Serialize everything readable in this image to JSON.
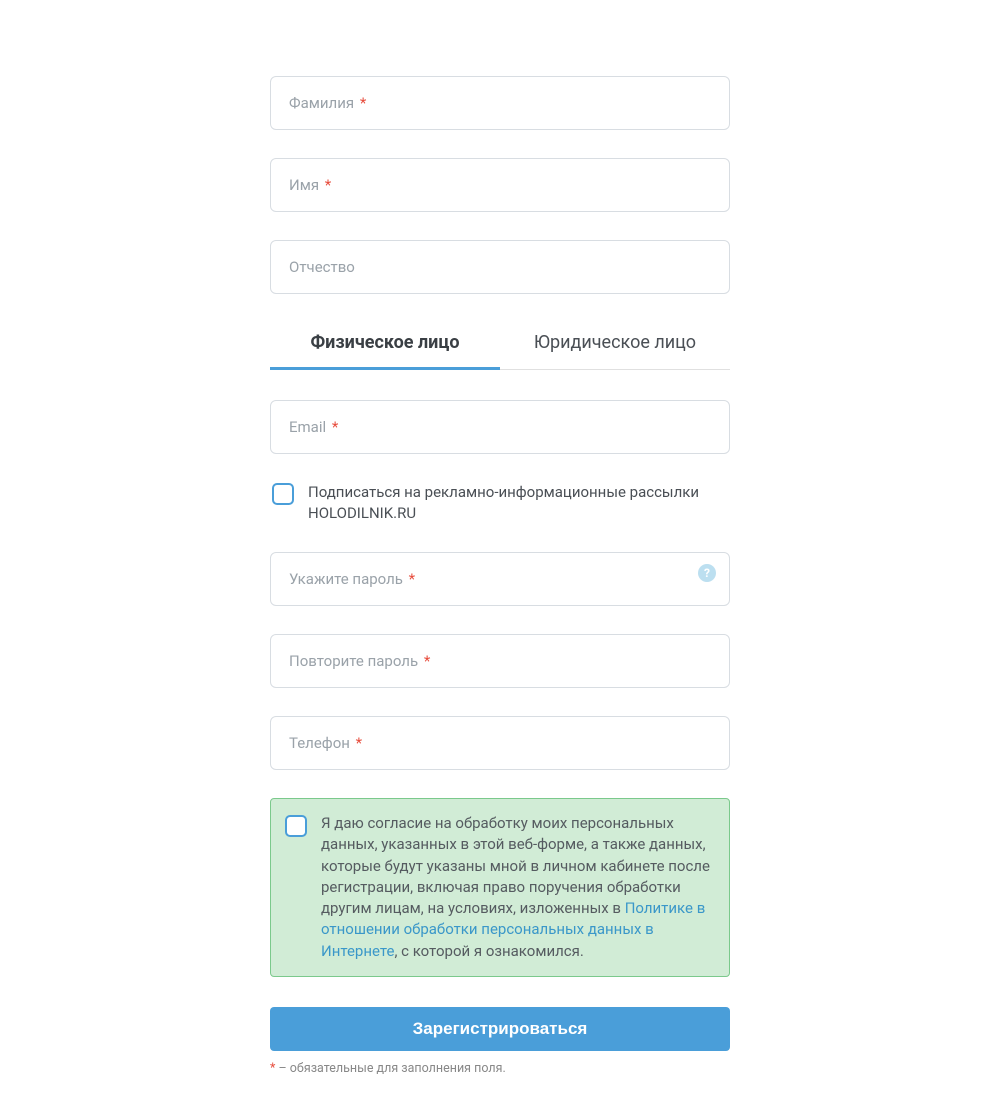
{
  "fields": {
    "lastname": {
      "placeholder": "Фамилия",
      "required": true
    },
    "firstname": {
      "placeholder": "Имя",
      "required": true
    },
    "patronymic": {
      "placeholder": "Отчество",
      "required": false
    },
    "email": {
      "placeholder": "Email",
      "required": true
    },
    "password": {
      "placeholder": "Укажите пароль",
      "required": true
    },
    "password_confirm": {
      "placeholder": "Повторите пароль",
      "required": true
    },
    "phone": {
      "placeholder": "Телефон",
      "required": true
    }
  },
  "required_mark": "*",
  "tabs": {
    "individual": "Физическое лицо",
    "legal": "Юридическое лицо"
  },
  "newsletter": {
    "label": "Подписаться на рекламно-информационные рассылки HOLODILNIK.RU"
  },
  "consent": {
    "text_before": "Я даю согласие на обработку моих персональных данных, указанных в этой веб-форме, а также данных, которые будут указаны мной в личном кабинете после регистрации, включая право поручения обработки другим лицам, на условиях, изложенных в ",
    "link_text": "Политике в отношении обработки персональных данных в Интернете",
    "text_after": ", с которой я ознакомился."
  },
  "submit_label": "Зарегистрироваться",
  "footnote": {
    "mark": "*",
    "text": " – обязательные для заполнения поля."
  },
  "help_icon_glyph": "?"
}
